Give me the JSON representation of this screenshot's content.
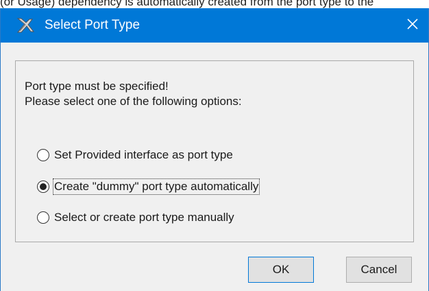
{
  "background": {
    "text": "(or Usage) dependency is automatically created from the port type to the"
  },
  "window": {
    "title": "Select Port Type",
    "close_symbol": "✕"
  },
  "message": {
    "line1": "Port type must be specified!",
    "line2": "Please select one of the following options:"
  },
  "options": [
    {
      "label": "Set Provided interface as port type",
      "selected": false
    },
    {
      "label": "Create \"dummy\" port type automatically",
      "selected": true
    },
    {
      "label": "Select or create port type manually",
      "selected": false
    }
  ],
  "buttons": {
    "ok": "OK",
    "cancel": "Cancel"
  },
  "colors": {
    "titlebar": "#0078d7",
    "dialog_bg": "#f0f0f0"
  },
  "icons": {
    "app": "magicdraw-app-icon",
    "close": "close-icon"
  }
}
